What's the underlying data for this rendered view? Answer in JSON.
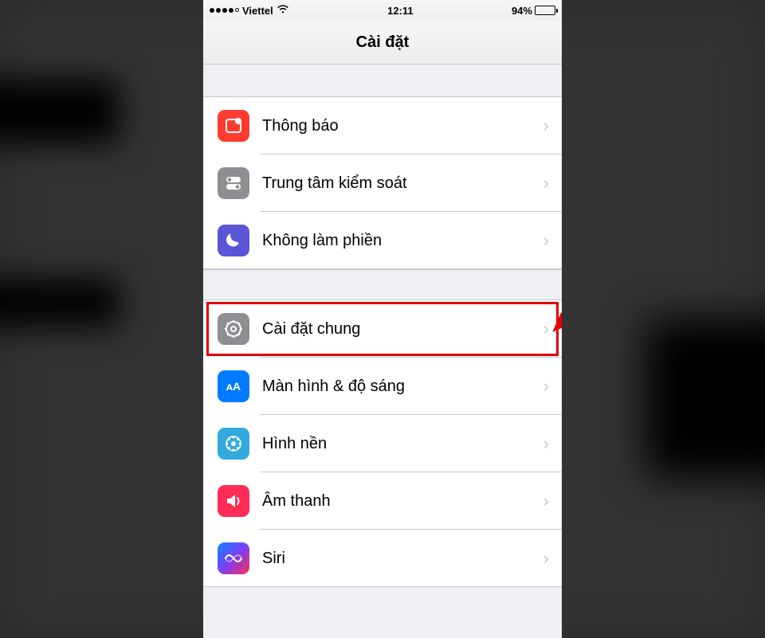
{
  "statusBar": {
    "carrier": "Viettel",
    "time": "12:11",
    "batteryPercent": "94%"
  },
  "header": {
    "title": "Cài đặt"
  },
  "group1": [
    {
      "label": "Thông báo",
      "iconName": "notification-icon"
    },
    {
      "label": "Trung tâm kiểm soát",
      "iconName": "control-center-icon"
    },
    {
      "label": "Không làm phiền",
      "iconName": "do-not-disturb-icon"
    }
  ],
  "group2": [
    {
      "label": "Cài đặt chung",
      "iconName": "general-icon",
      "highlighted": true
    },
    {
      "label": "Màn hình & độ sáng",
      "iconName": "display-icon"
    },
    {
      "label": "Hình nền",
      "iconName": "wallpaper-icon"
    },
    {
      "label": "Âm thanh",
      "iconName": "sound-icon"
    },
    {
      "label": "Siri",
      "iconName": "siri-icon"
    }
  ]
}
